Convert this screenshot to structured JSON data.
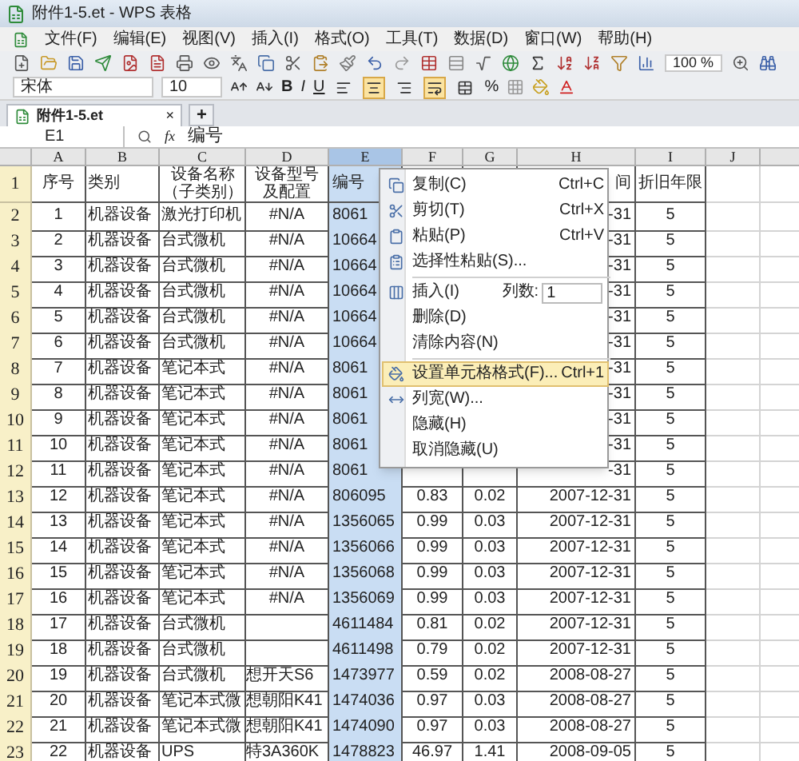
{
  "window": {
    "title": "附件1-5.et - WPS 表格"
  },
  "menu_bar": [
    "文件(F)",
    "编辑(E)",
    "视图(V)",
    "插入(I)",
    "格式(O)",
    "工具(T)",
    "数据(D)",
    "窗口(W)",
    "帮助(H)"
  ],
  "toolbar": {
    "zoom": "100 %"
  },
  "format_toolbar": {
    "font": "宋体",
    "size": "10",
    "bold": "B",
    "italic": "I",
    "underline": "U",
    "percent": "%",
    "toggles": [
      {
        "on": false
      },
      {
        "on": true
      },
      {
        "on": false
      },
      {
        "on": true
      },
      {
        "on": false
      }
    ]
  },
  "doc_tabs": [
    {
      "label": "附件1-5.et",
      "selected": true,
      "close": "×"
    }
  ],
  "new_tab": "+",
  "formula_bar": {
    "cell_ref": "E1",
    "function_label": "fx",
    "formula": "编号"
  },
  "sheet": {
    "columns": [
      {
        "label": "A",
        "selected": false
      },
      {
        "label": "B",
        "selected": false
      },
      {
        "label": "C",
        "selected": false
      },
      {
        "label": "D",
        "selected": false
      },
      {
        "label": "E",
        "selected": true
      },
      {
        "label": "F",
        "selected": false
      },
      {
        "label": "G",
        "selected": false
      },
      {
        "label": "H",
        "selected": false
      },
      {
        "label": "I",
        "selected": false
      },
      {
        "label": "J",
        "selected": false
      }
    ],
    "rows": [
      {
        "number": "1",
        "cells": {
          "a": "序号",
          "b": "类别",
          "c": [
            "设备名称",
            "（子类别）"
          ],
          "d": [
            "设备型号",
            "及配置"
          ],
          "e": "编号",
          "h": "间",
          "i": "折旧年限"
        }
      },
      {
        "number": "2",
        "cells": {
          "a": "1",
          "b": "机器设备",
          "c": "激光打印机",
          "d": "#N/A",
          "e": "8061",
          "h": "-31",
          "i": "5"
        }
      },
      {
        "number": "3",
        "cells": {
          "a": "2",
          "b": "机器设备",
          "c": "台式微机",
          "d": "#N/A",
          "e": "10664",
          "h": "-31",
          "i": "5"
        }
      },
      {
        "number": "4",
        "cells": {
          "a": "3",
          "b": "机器设备",
          "c": "台式微机",
          "d": "#N/A",
          "e": "10664",
          "h": "-31",
          "i": "5"
        }
      },
      {
        "number": "5",
        "cells": {
          "a": "4",
          "b": "机器设备",
          "c": "台式微机",
          "d": "#N/A",
          "e": "10664",
          "h": "-31",
          "i": "5"
        }
      },
      {
        "number": "6",
        "cells": {
          "a": "5",
          "b": "机器设备",
          "c": "台式微机",
          "d": "#N/A",
          "e": "10664",
          "h": "-31",
          "i": "5"
        }
      },
      {
        "number": "7",
        "cells": {
          "a": "6",
          "b": "机器设备",
          "c": "台式微机",
          "d": "#N/A",
          "e": "10664",
          "h": "-31",
          "i": "5"
        }
      },
      {
        "number": "8",
        "cells": {
          "a": "7",
          "b": "机器设备",
          "c": "笔记本式",
          "d": "#N/A",
          "e": "8061",
          "h": "-31",
          "i": "5"
        }
      },
      {
        "number": "9",
        "cells": {
          "a": "8",
          "b": "机器设备",
          "c": "笔记本式",
          "d": "#N/A",
          "e": "8061",
          "h": "-31",
          "i": "5"
        }
      },
      {
        "number": "10",
        "cells": {
          "a": "9",
          "b": "机器设备",
          "c": "笔记本式",
          "d": "#N/A",
          "e": "8061",
          "h": "-31",
          "i": "5"
        }
      },
      {
        "number": "11",
        "cells": {
          "a": "10",
          "b": "机器设备",
          "c": "笔记本式",
          "d": "#N/A",
          "e": "8061",
          "h": "-31",
          "i": "5"
        }
      },
      {
        "number": "12",
        "cells": {
          "a": "11",
          "b": "机器设备",
          "c": "笔记本式",
          "d": "#N/A",
          "e": "8061",
          "h": "-31",
          "i": "5"
        }
      },
      {
        "number": "13",
        "cells": {
          "a": "12",
          "b": "机器设备",
          "c": "笔记本式",
          "d": "#N/A",
          "e": "806095",
          "f": "0.83",
          "g": "0.02",
          "h": "2007-12-31",
          "i": "5"
        }
      },
      {
        "number": "14",
        "cells": {
          "a": "13",
          "b": "机器设备",
          "c": "笔记本式",
          "d": "#N/A",
          "e": "1356065",
          "f": "0.99",
          "g": "0.03",
          "h": "2007-12-31",
          "i": "5"
        }
      },
      {
        "number": "15",
        "cells": {
          "a": "14",
          "b": "机器设备",
          "c": "笔记本式",
          "d": "#N/A",
          "e": "1356066",
          "f": "0.99",
          "g": "0.03",
          "h": "2007-12-31",
          "i": "5"
        }
      },
      {
        "number": "16",
        "cells": {
          "a": "15",
          "b": "机器设备",
          "c": "笔记本式",
          "d": "#N/A",
          "e": "1356068",
          "f": "0.99",
          "g": "0.03",
          "h": "2007-12-31",
          "i": "5"
        }
      },
      {
        "number": "17",
        "cells": {
          "a": "16",
          "b": "机器设备",
          "c": "笔记本式",
          "d": "#N/A",
          "e": "1356069",
          "f": "0.99",
          "g": "0.03",
          "h": "2007-12-31",
          "i": "5"
        }
      },
      {
        "number": "18",
        "cells": {
          "a": "17",
          "b": "机器设备",
          "c": "台式微机",
          "e": "4611484",
          "f": "0.81",
          "g": "0.02",
          "h": "2007-12-31",
          "i": "5"
        }
      },
      {
        "number": "19",
        "cells": {
          "a": "18",
          "b": "机器设备",
          "c": "台式微机",
          "e": "4611498",
          "f": "0.79",
          "g": "0.02",
          "h": "2007-12-31",
          "i": "5"
        }
      },
      {
        "number": "20",
        "cells": {
          "a": "19",
          "b": "机器设备",
          "c": "台式微机",
          "d": "想开天S6",
          "e": "1473977",
          "f": "0.59",
          "g": "0.02",
          "h": "2008-08-27",
          "i": "5"
        }
      },
      {
        "number": "21",
        "cells": {
          "a": "20",
          "b": "机器设备",
          "c": "笔记本式微",
          "d": "想朝阳K41",
          "e": "1474036",
          "f": "0.97",
          "g": "0.03",
          "h": "2008-08-27",
          "i": "5"
        }
      },
      {
        "number": "22",
        "cells": {
          "a": "21",
          "b": "机器设备",
          "c": "笔记本式微",
          "d": "想朝阳K41",
          "e": "1474090",
          "f": "0.97",
          "g": "0.03",
          "h": "2008-08-27",
          "i": "5"
        }
      },
      {
        "number": "23",
        "cells": {
          "a": "22",
          "b": "机器设备",
          "c": "UPS",
          "d": "特3A360K",
          "e": "1478823",
          "f": "46.97",
          "g": "1.41",
          "h": "2008-09-05",
          "i": "5"
        }
      }
    ]
  },
  "context_menu": {
    "items": [
      {
        "kind": "item",
        "label": "复制(C)",
        "shortcut": "Ctrl+C",
        "selected": false
      },
      {
        "kind": "item",
        "label": "剪切(T)",
        "shortcut": "Ctrl+X",
        "selected": false
      },
      {
        "kind": "item",
        "label": "粘贴(P)",
        "shortcut": "Ctrl+V",
        "selected": false
      },
      {
        "kind": "item",
        "label": "选择性粘贴(S)...",
        "selected": false
      },
      {
        "kind": "separator"
      },
      {
        "kind": "insert",
        "label": "插入(I)",
        "count_label": "列数:",
        "count": "1",
        "selected": false
      },
      {
        "kind": "item",
        "label": "删除(D)",
        "selected": false
      },
      {
        "kind": "item",
        "label": "清除内容(N)",
        "selected": false
      },
      {
        "kind": "separator"
      },
      {
        "kind": "item",
        "label": "设置单元格格式(F)...",
        "shortcut": "Ctrl+1",
        "selected": true
      },
      {
        "kind": "item",
        "label": "列宽(W)...",
        "selected": false
      },
      {
        "kind": "item",
        "label": "隐藏(H)",
        "selected": false
      },
      {
        "kind": "item",
        "label": "取消隐藏(U)",
        "selected": false
      }
    ]
  }
}
